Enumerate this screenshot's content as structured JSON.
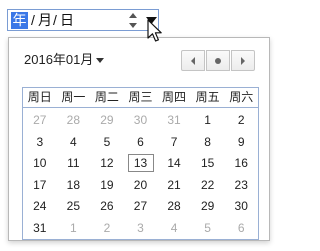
{
  "date_input": {
    "year_placeholder": "年",
    "separator": "/",
    "month_placeholder": "月",
    "day_placeholder": "日"
  },
  "picker": {
    "month_label": "2016年01月",
    "weekdays": [
      "周日",
      "周一",
      "周二",
      "周三",
      "周四",
      "周五",
      "周六"
    ],
    "weeks": [
      [
        {
          "d": "27",
          "m": true
        },
        {
          "d": "28",
          "m": true
        },
        {
          "d": "29",
          "m": true
        },
        {
          "d": "30",
          "m": true
        },
        {
          "d": "31",
          "m": true
        },
        {
          "d": "1"
        },
        {
          "d": "2"
        }
      ],
      [
        {
          "d": "3"
        },
        {
          "d": "4"
        },
        {
          "d": "5"
        },
        {
          "d": "6"
        },
        {
          "d": "7"
        },
        {
          "d": "8"
        },
        {
          "d": "9"
        }
      ],
      [
        {
          "d": "10"
        },
        {
          "d": "11"
        },
        {
          "d": "12"
        },
        {
          "d": "13",
          "t": true
        },
        {
          "d": "14"
        },
        {
          "d": "15"
        },
        {
          "d": "16"
        }
      ],
      [
        {
          "d": "17"
        },
        {
          "d": "18"
        },
        {
          "d": "19"
        },
        {
          "d": "20"
        },
        {
          "d": "21"
        },
        {
          "d": "22"
        },
        {
          "d": "23"
        }
      ],
      [
        {
          "d": "24"
        },
        {
          "d": "25"
        },
        {
          "d": "26"
        },
        {
          "d": "27"
        },
        {
          "d": "28"
        },
        {
          "d": "29"
        },
        {
          "d": "30"
        }
      ],
      [
        {
          "d": "31"
        },
        {
          "d": "1",
          "m": true
        },
        {
          "d": "2",
          "m": true
        },
        {
          "d": "3",
          "m": true
        },
        {
          "d": "4",
          "m": true
        },
        {
          "d": "5",
          "m": true
        },
        {
          "d": "6",
          "m": true
        }
      ]
    ]
  },
  "colors": {
    "selection": "#3b78e7",
    "focus_border": "#7a9cd3",
    "muted_text": "#aaaaaa"
  },
  "icons": {
    "spinner": "up-down-arrows-icon",
    "dropdown": "triangle-down-icon",
    "prev": "triangle-left-icon",
    "today": "dot-icon",
    "next": "triangle-right-icon",
    "cursor": "mouse-pointer-icon"
  }
}
